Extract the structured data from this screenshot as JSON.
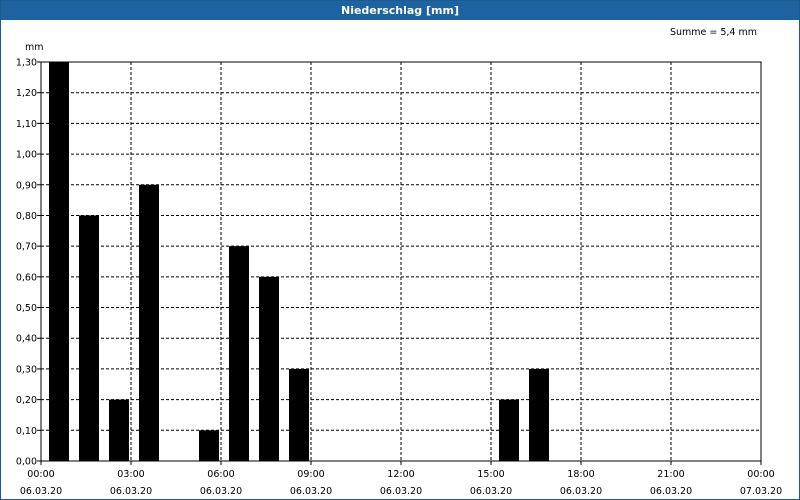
{
  "window": {
    "title": "Niederschlag [mm]"
  },
  "summary": {
    "total": "Summe = 5,4 mm"
  },
  "chart_data": {
    "type": "bar",
    "title": "Niederschlag [mm]",
    "ylabel": "mm",
    "ylim": [
      0,
      1.3
    ],
    "yticks": [
      "0,00",
      "0,10",
      "0,20",
      "0,30",
      "0,40",
      "0,50",
      "0,60",
      "0,70",
      "0,80",
      "0,90",
      "1,00",
      "1,10",
      "1,20",
      "1,30"
    ],
    "xlim_hours": [
      0,
      24
    ],
    "xticks": [
      {
        "time": "00:00",
        "date": "06.03.20"
      },
      {
        "time": "03:00",
        "date": "06.03.20"
      },
      {
        "time": "06:00",
        "date": "06.03.20"
      },
      {
        "time": "09:00",
        "date": "06.03.20"
      },
      {
        "time": "12:00",
        "date": "06.03.20"
      },
      {
        "time": "15:00",
        "date": "06.03.20"
      },
      {
        "time": "18:00",
        "date": "06.03.20"
      },
      {
        "time": "21:00",
        "date": "06.03.20"
      },
      {
        "time": "00:00",
        "date": "07.03.20"
      }
    ],
    "categories": [
      "00:00",
      "01:00",
      "02:00",
      "03:00",
      "04:00",
      "05:00",
      "06:00",
      "07:00",
      "08:00",
      "09:00",
      "10:00",
      "11:00",
      "12:00",
      "13:00",
      "14:00",
      "15:00",
      "16:00",
      "17:00",
      "18:00",
      "19:00",
      "20:00",
      "21:00",
      "22:00",
      "23:00"
    ],
    "values": [
      1.3,
      0.8,
      0.2,
      0.9,
      0,
      0.1,
      0.7,
      0.6,
      0.3,
      0,
      0,
      0,
      0,
      0,
      0,
      0.2,
      0.3,
      0,
      0,
      0,
      0,
      0,
      0,
      0
    ],
    "bar_color": "#000000",
    "grid": true
  }
}
